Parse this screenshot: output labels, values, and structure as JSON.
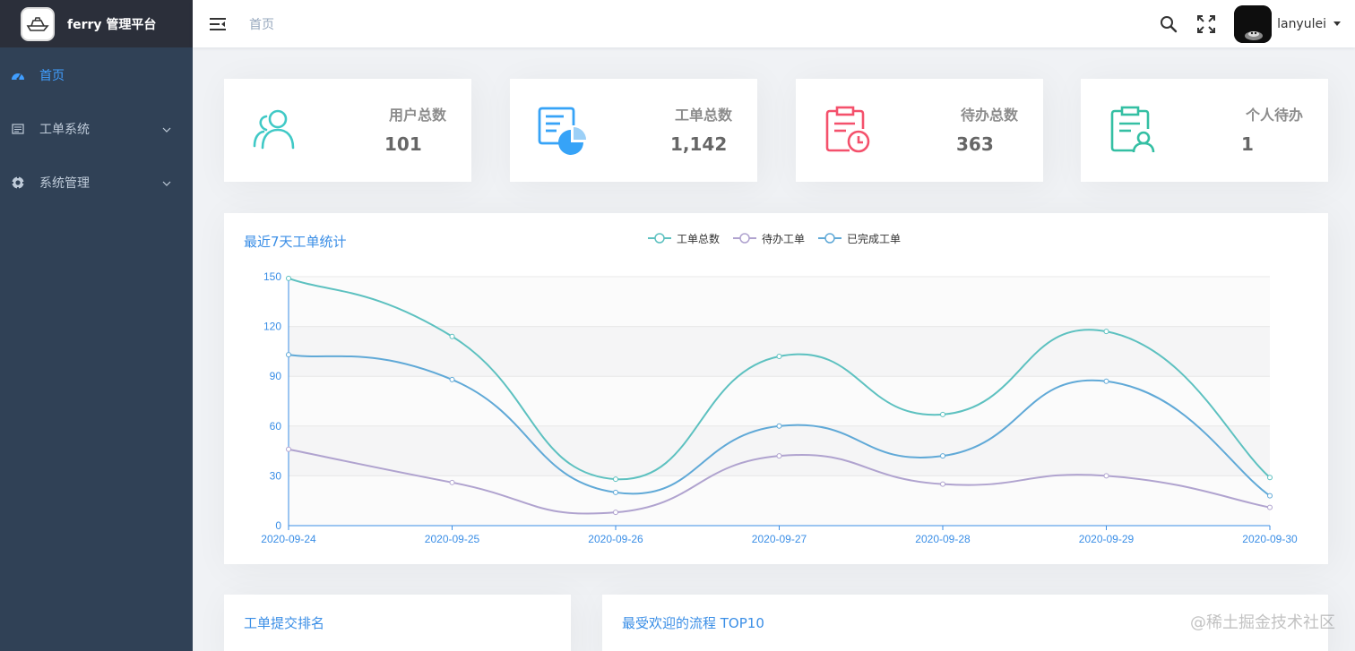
{
  "app": {
    "title": "ferry 管理平台"
  },
  "sidebar": {
    "items": [
      {
        "label": "首页",
        "icon": "dashboard-icon",
        "active": true
      },
      {
        "label": "工单系统",
        "icon": "ticket-icon",
        "has_children": true
      },
      {
        "label": "系统管理",
        "icon": "settings-icon",
        "has_children": true
      }
    ]
  },
  "navbar": {
    "breadcrumb": "首页",
    "username": "lanyulei"
  },
  "stats": [
    {
      "label": "用户总数",
      "value": "101",
      "icon": "users-icon",
      "color": "#40c9c6"
    },
    {
      "label": "工单总数",
      "value": "1,142",
      "icon": "ticket-chart-icon",
      "color": "#36a3f7"
    },
    {
      "label": "待办总数",
      "value": "363",
      "icon": "clipboard-clock-icon",
      "color": "#f4516c"
    },
    {
      "label": "个人待办",
      "value": "1",
      "icon": "clipboard-user-icon",
      "color": "#34bfa3"
    }
  ],
  "chart_data": {
    "type": "line",
    "title": "最近7天工单统计",
    "categories": [
      "2020-09-24",
      "2020-09-25",
      "2020-09-26",
      "2020-09-27",
      "2020-09-28",
      "2020-09-29",
      "2020-09-30"
    ],
    "ylim": [
      0,
      150
    ],
    "yticks": [
      0,
      30,
      60,
      90,
      120,
      150
    ],
    "legend_position": "top-center",
    "series": [
      {
        "name": "工单总数",
        "color": "#5dc1c0",
        "values": [
          149,
          114,
          28,
          102,
          67,
          117,
          29
        ]
      },
      {
        "name": "待办工单",
        "color": "#b0a3cf",
        "values": [
          46,
          26,
          8,
          42,
          25,
          30,
          11
        ]
      },
      {
        "name": "已完成工单",
        "color": "#60a9d7",
        "values": [
          103,
          88,
          20,
          60,
          42,
          87,
          18
        ]
      }
    ]
  },
  "bottom": {
    "left_title": "工单提交排名",
    "right_title": "最受欢迎的流程 TOP10",
    "watermark": "@稀土掘金技术社区"
  }
}
